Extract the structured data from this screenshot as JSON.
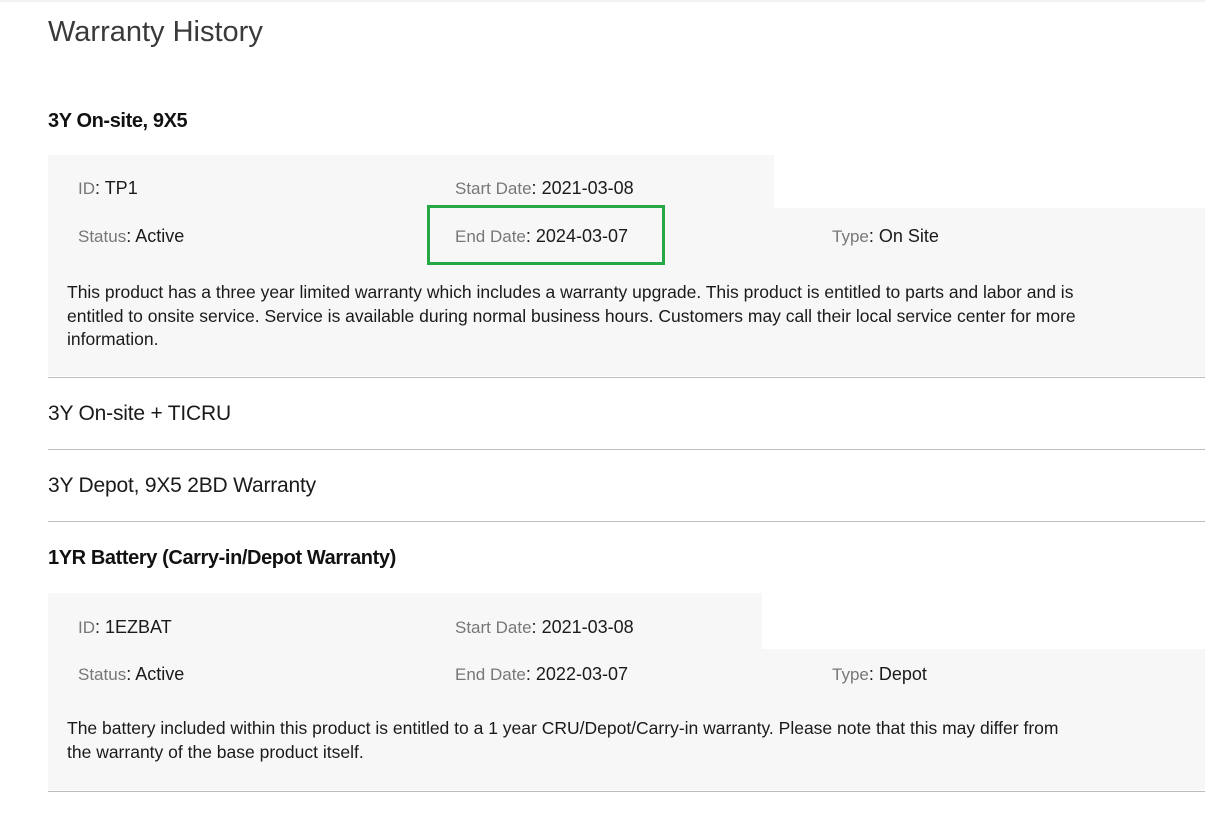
{
  "page_title": "Warranty History",
  "colors": {
    "panel_background": "#f7f7f7",
    "highlight_border": "#28a745",
    "label_text": "#777777",
    "divider": "#bdbdbd"
  },
  "warranties": [
    {
      "title": "3Y On-site, 9X5",
      "expanded": true,
      "id_label": "ID",
      "id_value": "TP1",
      "start_label": "Start Date",
      "start_value": "2021-03-08",
      "status_label": "Status",
      "status_value": "Active",
      "end_label": "End Date",
      "end_value": "2024-03-07",
      "type_label": "Type",
      "type_value": "On Site",
      "description_lines": [
        "This product has a three year limited warranty which includes a warranty upgrade. This product is entitled to parts and labor and is",
        "entitled to onsite service. Service is available during normal business hours. Customers may call their local service center for more",
        "information."
      ]
    },
    {
      "title": "3Y On-site + TICRU",
      "expanded": false
    },
    {
      "title": "3Y Depot, 9X5 2BD Warranty",
      "expanded": false
    },
    {
      "title": "1YR Battery (Carry-in/Depot Warranty)",
      "expanded": true,
      "id_label": "ID",
      "id_value": "1EZBAT",
      "start_label": "Start Date",
      "start_value": "2021-03-08",
      "status_label": "Status",
      "status_value": "Active",
      "end_label": "End Date",
      "end_value": "2022-03-07",
      "type_label": "Type",
      "type_value": "Depot",
      "description_lines": [
        "The battery included within this product is entitled to a 1 year CRU/Depot/Carry-in warranty. Please note that this may differ from",
        "the warranty of the base product itself."
      ]
    }
  ]
}
